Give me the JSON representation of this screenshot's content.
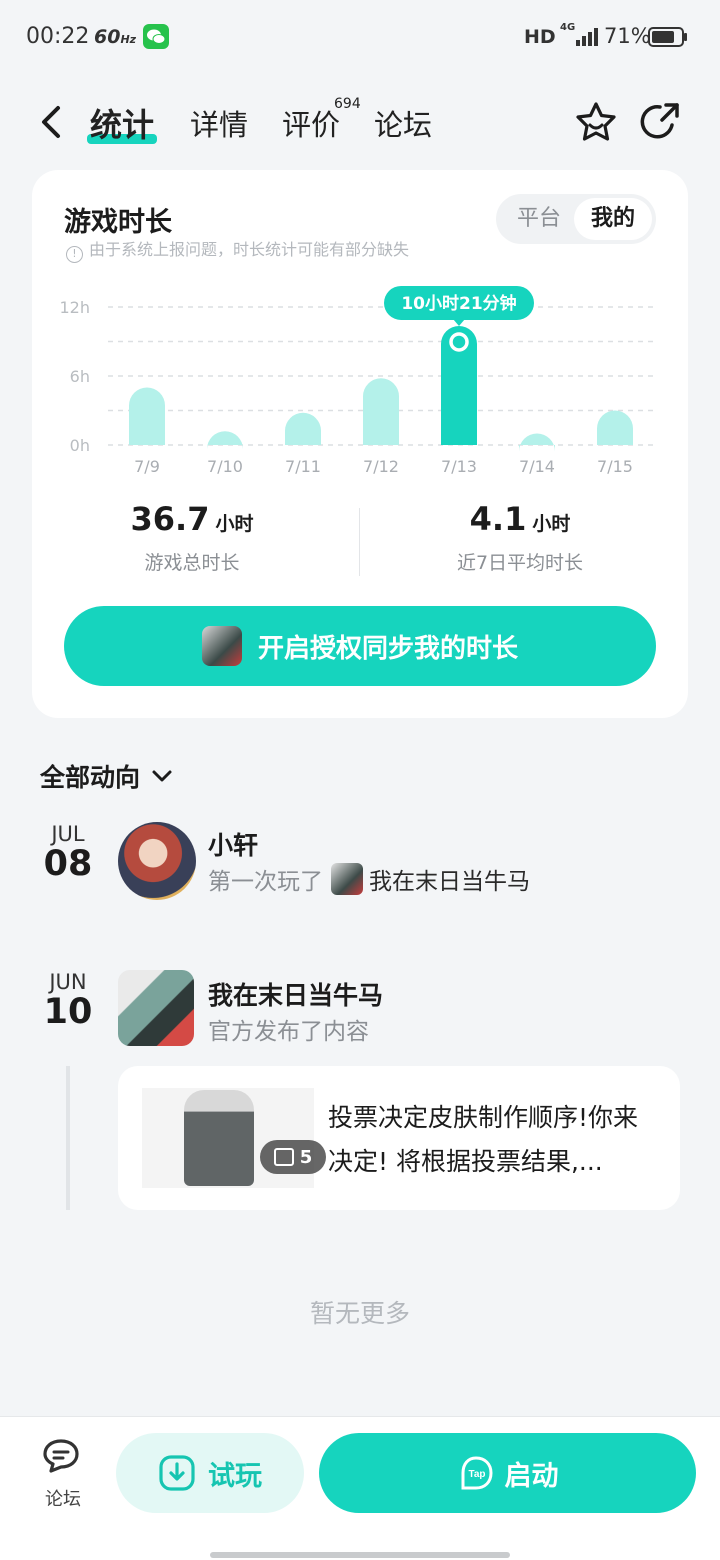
{
  "status_bar": {
    "time": "00:22",
    "refresh_rate": "60",
    "refresh_unit": "Hz",
    "hd": "HD",
    "network": "4G",
    "battery": "71%"
  },
  "nav": {
    "tabs": [
      "统计",
      "详情",
      "评价",
      "论坛"
    ],
    "active_tab": "统计",
    "review_count": "694"
  },
  "stats_card": {
    "title": "游戏时长",
    "note": "由于系统上报问题，时长统计可能有部分缺失",
    "toggle": {
      "options": [
        "平台",
        "我的"
      ],
      "selected": "我的"
    },
    "summary": [
      {
        "value": "36.7",
        "unit": "小时",
        "label": "游戏总时长"
      },
      {
        "value": "4.1",
        "unit": "小时",
        "label": "近7日平均时长"
      }
    ],
    "sync_button": "开启授权同步我的时长"
  },
  "chart_data": {
    "type": "bar",
    "categories": [
      "7/9",
      "7/10",
      "7/11",
      "7/12",
      "7/13",
      "7/14",
      "7/15"
    ],
    "values": [
      5.0,
      1.2,
      2.8,
      5.8,
      10.35,
      1.0,
      3.0
    ],
    "unit": "h",
    "y_ticks": [
      "0h",
      "6h",
      "12h"
    ],
    "ylim": [
      0,
      12
    ],
    "highlight_index": 4,
    "highlight_label": "10小时21分钟",
    "grid": true,
    "colors": {
      "bar": "#b4f1ea",
      "highlight": "#16d4be",
      "grid": "#dcdfe2"
    }
  },
  "activity": {
    "header": "全部动向",
    "items": [
      {
        "month": "JUL",
        "day": "08",
        "name": "小轩",
        "desc_prefix": "第一次玩了",
        "game": "我在末日当牛马"
      },
      {
        "month": "JUN",
        "day": "10",
        "name": "我在末日当牛马",
        "desc": "官方发布了内容",
        "post": {
          "image_count": "5",
          "text": "投票决定皮肤制作顺序!你来决定! 将根据投票结果,..."
        }
      }
    ],
    "no_more": "暂无更多"
  },
  "bottom_bar": {
    "forum_label": "论坛",
    "trial_label": "试玩",
    "launch_label": "启动",
    "launch_icon_text": "Tap"
  },
  "colors": {
    "accent": "#16d4be",
    "accent_light": "#e3f8f5",
    "bar_light": "#b4f1ea",
    "background": "#f3f5f7"
  }
}
